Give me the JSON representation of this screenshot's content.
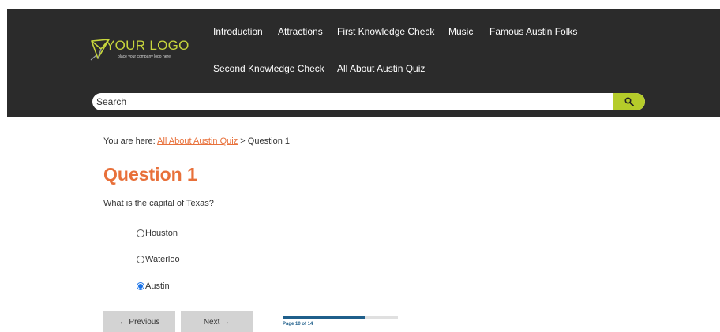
{
  "colors": {
    "header_bg": "#2b2b2b",
    "accent_orange": "#e8703a",
    "logo_green": "#c7d63c",
    "search_button_green": "#b5cc2a",
    "progress_blue": "#1f5f8b",
    "radio_blue": "#1a73e8"
  },
  "logo": {
    "title": "YOUR LOGO",
    "subtitle": "place your company logo here",
    "icon": "paper-plane-icon"
  },
  "nav": {
    "items": [
      {
        "label": "Introduction"
      },
      {
        "label": "Attractions"
      },
      {
        "label": "First Knowledge Check"
      },
      {
        "label": "Music"
      },
      {
        "label": "Famous Austin Folks"
      },
      {
        "label": "Second Knowledge Check"
      },
      {
        "label": "All About Austin Quiz"
      }
    ]
  },
  "search": {
    "placeholder": "Search",
    "button_icon": "search-icon"
  },
  "breadcrumb": {
    "prefix": "You are here:",
    "link": "All About Austin Quiz",
    "separator": ">",
    "current": "Question 1"
  },
  "page": {
    "title": "Question 1",
    "question": "What is the capital of Texas?"
  },
  "options": [
    {
      "label": "Houston",
      "checked": false
    },
    {
      "label": "Waterloo",
      "checked": false
    },
    {
      "label": "Austin",
      "checked": true
    }
  ],
  "pagination": {
    "previous_label": "← Previous",
    "next_label": "Next →",
    "page_text": "Page 10 of 14",
    "current_page": 10,
    "total_pages": 14,
    "progress_fraction": 0.714
  }
}
